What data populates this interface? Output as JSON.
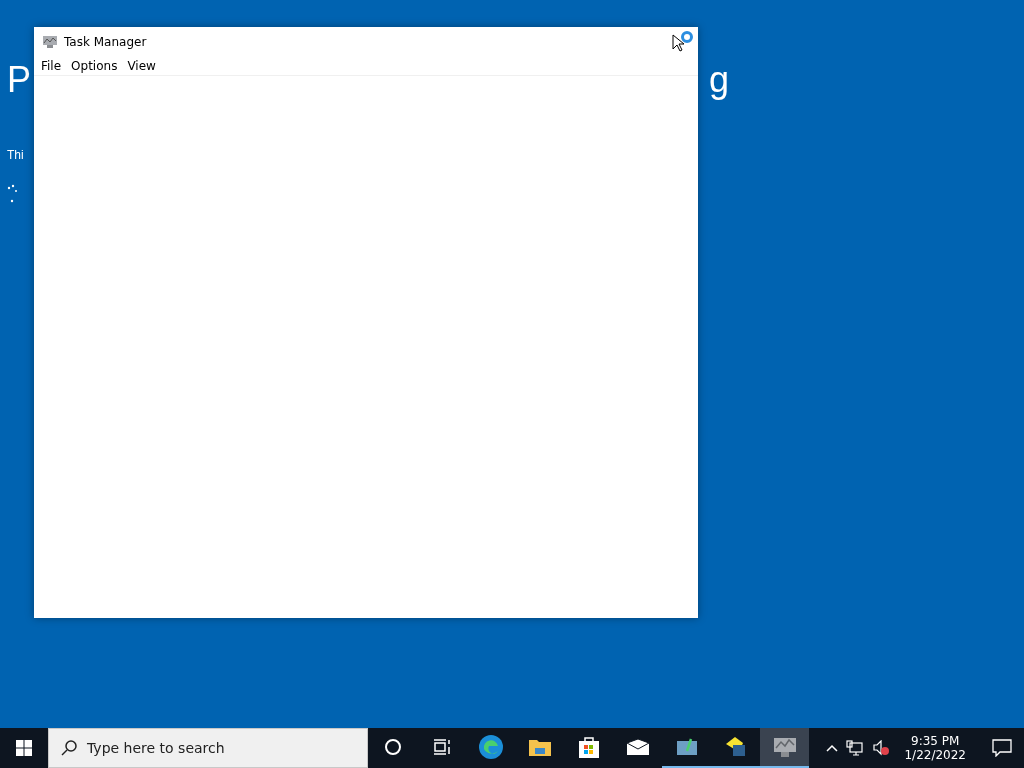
{
  "desktop": {
    "heading_left": "P",
    "heading_right": "g",
    "subtitle": "Thi"
  },
  "window": {
    "title": "Task Manager",
    "menu": [
      "File",
      "Options",
      "View"
    ]
  },
  "taskbar": {
    "search": {
      "placeholder": "Type here to search"
    },
    "apps": [
      {
        "kind": "cortana",
        "running": false,
        "active": false
      },
      {
        "kind": "taskview",
        "running": false,
        "active": false
      },
      {
        "kind": "edge",
        "running": false,
        "active": false
      },
      {
        "kind": "folder",
        "running": false,
        "active": false
      },
      {
        "kind": "store",
        "running": false,
        "active": false
      },
      {
        "kind": "mail",
        "running": false,
        "active": false
      },
      {
        "kind": "monitor",
        "running": true,
        "active": false
      },
      {
        "kind": "calculator",
        "running": true,
        "active": false
      },
      {
        "kind": "taskmanager",
        "running": true,
        "active": true
      }
    ],
    "tray": {
      "volume_muted": true,
      "time": "9:35 PM",
      "date": "1/22/2022"
    }
  }
}
